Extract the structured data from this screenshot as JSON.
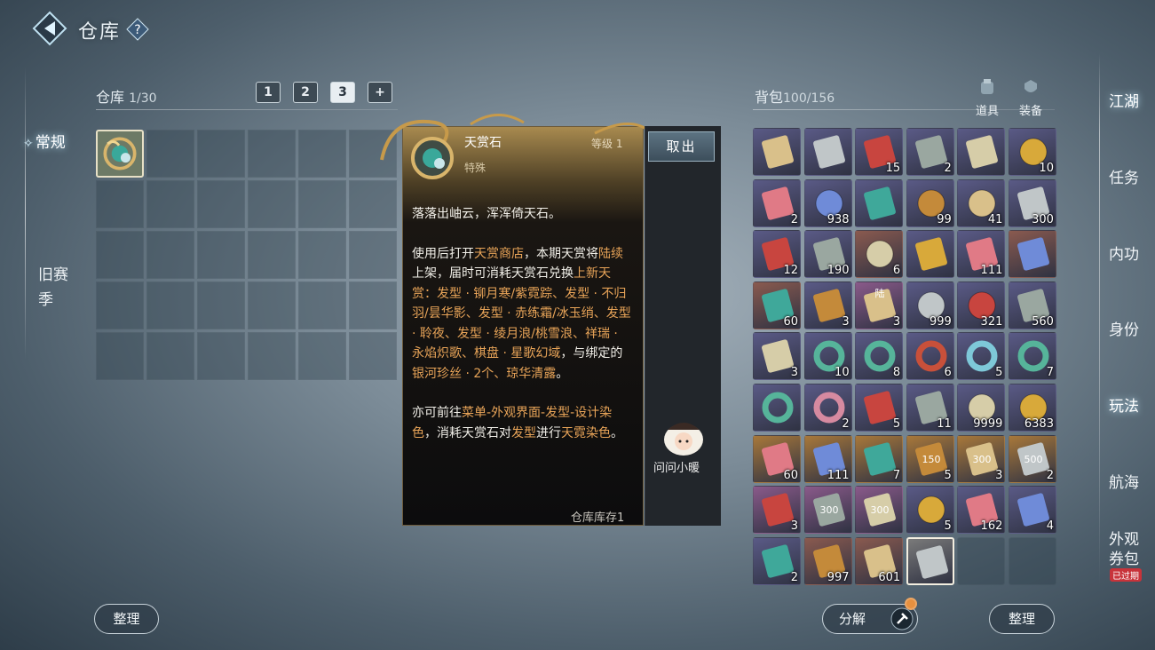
{
  "header": {
    "title": "仓库",
    "help_icon": "question-icon"
  },
  "left_nav": {
    "items": [
      {
        "label": "常规",
        "active": true
      },
      {
        "label": "旧赛季",
        "active": false
      }
    ]
  },
  "warehouse": {
    "title": "仓库",
    "count": "1/30",
    "tabs": [
      "1",
      "2",
      "3",
      "+"
    ],
    "active_tab": "3",
    "items": [
      {
        "name": "天赏石",
        "icon": "jade-ornament-icon"
      }
    ],
    "sort_label": "整理"
  },
  "tooltip": {
    "name": "天赏石",
    "level": "等级 1",
    "type": "特殊",
    "take_out_label": "取出",
    "p1": "落落出岫云，浑浑倚天石。",
    "p2_segments": [
      {
        "t": "使用后打开",
        "h": false
      },
      {
        "t": "天赏商店",
        "h": true
      },
      {
        "t": "，本期天赏将",
        "h": false
      },
      {
        "t": "陆续",
        "h": true
      },
      {
        "t": "上架，届时可消耗天赏石兑换",
        "h": false
      },
      {
        "t": "上新天赏：发型 · 铆月寒/紫霓踪、发型 · 不归羽/昙华影、发型 · 赤练霜/冰玉绡、发型 · 聆夜、发型 · 绫月浪/桃雪浪、祥瑞 · 永焰炽歌、棋盘 · 星歌幻域",
        "h": true
      },
      {
        "t": "，与绑定的",
        "h": false
      },
      {
        "t": "银河珍丝 · 2个、琼华清露",
        "h": true
      },
      {
        "t": "。",
        "h": false
      }
    ],
    "p3_segments": [
      {
        "t": "亦可前往",
        "h": false
      },
      {
        "t": "菜单-外观界面-发型-设计染色",
        "h": true
      },
      {
        "t": "，消耗天赏石对",
        "h": false
      },
      {
        "t": "发型",
        "h": true
      },
      {
        "t": "进行",
        "h": false
      },
      {
        "t": "天霓染色",
        "h": true
      },
      {
        "t": "。",
        "h": false
      }
    ],
    "stock": "仓库库存1",
    "asker_label": "问问小暖"
  },
  "bag": {
    "title": "背包",
    "count": "100/156",
    "tabs": [
      {
        "label": "道具",
        "icon": "props-icon"
      },
      {
        "label": "装备",
        "icon": "equipment-icon"
      }
    ],
    "items": [
      {
        "icon": "scroll",
        "qty": "",
        "bg": "#5a5a86"
      },
      {
        "icon": "ore",
        "qty": "",
        "bg": "#5a5a86"
      },
      {
        "icon": "red-pouch",
        "qty": "15",
        "bg": "#5a5a86"
      },
      {
        "icon": "stone-slab",
        "qty": "2",
        "bg": "#5a5a86"
      },
      {
        "icon": "map",
        "qty": "",
        "bg": "#5a5a86"
      },
      {
        "icon": "gold-coin",
        "qty": "10",
        "bg": "#5a5a86"
      },
      {
        "icon": "red-box",
        "qty": "2",
        "bg": "#5a5a86"
      },
      {
        "icon": "pink-orb",
        "qty": "938",
        "bg": "#5a5a86"
      },
      {
        "icon": "paper",
        "qty": "",
        "bg": "#5a5a86"
      },
      {
        "icon": "crystal-ball",
        "qty": "99",
        "bg": "#5a5a86"
      },
      {
        "icon": "crystal-ball",
        "qty": "41",
        "bg": "#5a5a86"
      },
      {
        "icon": "gold-fish",
        "qty": "300",
        "bg": "#5a5a86"
      },
      {
        "icon": "lantern",
        "qty": "12",
        "bg": "#5a5a86"
      },
      {
        "icon": "chest",
        "qty": "190",
        "bg": "#5a5a86"
      },
      {
        "icon": "purple-gem",
        "qty": "6",
        "bg": "#8a5a4f"
      },
      {
        "icon": "fan",
        "qty": "",
        "bg": "#5a5a86"
      },
      {
        "icon": "lantern-red",
        "qty": "111",
        "bg": "#5a5a86"
      },
      {
        "icon": "ore",
        "qty": "",
        "bg": "#8a5a4f"
      },
      {
        "icon": "bowl",
        "qty": "60",
        "bg": "#8a5a4f"
      },
      {
        "icon": "bamboo",
        "qty": "3",
        "bg": "#5a5a86"
      },
      {
        "icon": "helmet",
        "qty": "3",
        "bg": "#8a5a8a",
        "tag": "陆"
      },
      {
        "icon": "compass",
        "qty": "999",
        "bg": "#5a5a86"
      },
      {
        "icon": "compass",
        "qty": "321",
        "bg": "#5a5a86"
      },
      {
        "icon": "crystal",
        "qty": "560",
        "bg": "#5a5a86"
      },
      {
        "icon": "ticket",
        "qty": "3",
        "bg": "#5a5a86"
      },
      {
        "icon": "jade-ring",
        "qty": "10",
        "bg": "#5a5a86"
      },
      {
        "icon": "jade-ring",
        "qty": "8",
        "bg": "#5a5a86"
      },
      {
        "icon": "red-ring",
        "qty": "6",
        "bg": "#5a5a86"
      },
      {
        "icon": "blue-ring",
        "qty": "5",
        "bg": "#5a5a86"
      },
      {
        "icon": "jade-ring",
        "qty": "7",
        "bg": "#5a5a86"
      },
      {
        "icon": "jade-ring",
        "qty": "",
        "bg": "#5a5a86"
      },
      {
        "icon": "pink-ring",
        "qty": "2",
        "bg": "#5a5a86"
      },
      {
        "icon": "gold-token",
        "qty": "5",
        "bg": "#5a5a86"
      },
      {
        "icon": "red-token",
        "qty": "11",
        "bg": "#5a5a86"
      },
      {
        "icon": "blue-gem",
        "qty": "9999",
        "bg": "#5a5a86"
      },
      {
        "icon": "blue-gem",
        "qty": "6383",
        "bg": "#5a5a86"
      },
      {
        "icon": "book-teal",
        "qty": "60",
        "bg": "#a8783a"
      },
      {
        "icon": "jade-book",
        "qty": "111",
        "bg": "#a8783a"
      },
      {
        "icon": "red-outfit",
        "qty": "7",
        "bg": "#a8783a"
      },
      {
        "icon": "coupon-150",
        "qty": "5",
        "bg": "#a8783a",
        "tag": "150"
      },
      {
        "icon": "coupon-300",
        "qty": "3",
        "bg": "#a8783a",
        "tag": "300"
      },
      {
        "icon": "coupon-500",
        "qty": "2",
        "bg": "#a8783a",
        "tag": "500"
      },
      {
        "icon": "coupon-gold",
        "qty": "3",
        "bg": "#8a5a8a"
      },
      {
        "icon": "coupon-300",
        "qty": "",
        "bg": "#8a5a8a",
        "tag": "300"
      },
      {
        "icon": "coupon-300",
        "qty": "",
        "bg": "#8a5a8a",
        "tag": "300"
      },
      {
        "icon": "crystal-orb",
        "qty": "5",
        "bg": "#5a5a86"
      },
      {
        "icon": "dark-lantern",
        "qty": "162",
        "bg": "#5a5a86"
      },
      {
        "icon": "scroll-box",
        "qty": "4",
        "bg": "#5a5a86"
      },
      {
        "icon": "green-book",
        "qty": "2",
        "bg": "#5a5a86"
      },
      {
        "icon": "silver-bar",
        "qty": "997",
        "bg": "#8a5a4f"
      },
      {
        "icon": "bowl-purple",
        "qty": "601",
        "bg": "#8a5a4f"
      },
      {
        "icon": "knife",
        "qty": "",
        "bg": "#7a7a7a",
        "selected": true
      },
      {
        "icon": "",
        "qty": "",
        "bg": ""
      },
      {
        "icon": "",
        "qty": "",
        "bg": ""
      }
    ],
    "decompose_label": "分解",
    "sort_label": "整理"
  },
  "right_nav": {
    "items": [
      "江湖",
      "任务",
      "内功",
      "身份",
      "玩法",
      "航海",
      "外观券包"
    ],
    "expired_badge": "已过期"
  }
}
